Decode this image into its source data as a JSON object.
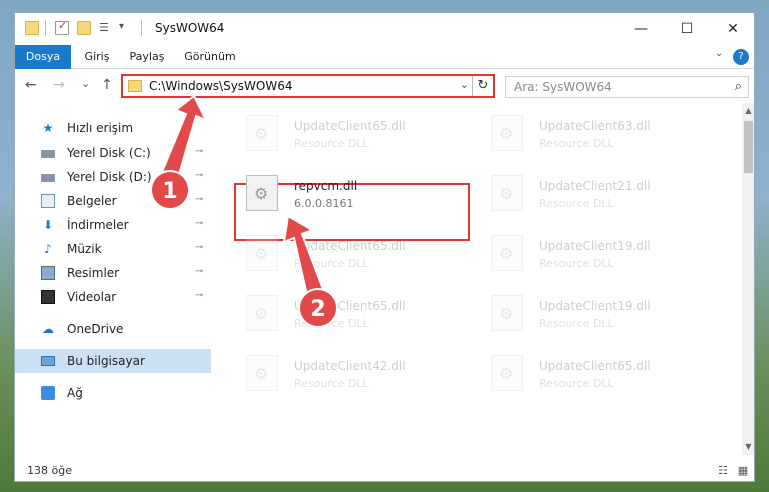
{
  "window": {
    "title": "SysWOW64",
    "controls": {
      "minimize": "—",
      "maximize": "☐",
      "close": "✕"
    }
  },
  "ribbon": {
    "tabs": [
      "Dosya",
      "Giriş",
      "Paylaş",
      "Görünüm"
    ],
    "help": "?",
    "collapse": "⌄"
  },
  "nav": {
    "back": "←",
    "forward": "→",
    "recent": "⌄",
    "up": "↑",
    "address": "C:\\Windows\\SysWOW64",
    "address_dropdown": "⌄",
    "refresh": "↻",
    "search_placeholder": "Ara: SysWOW64",
    "search_icon": "⌕"
  },
  "sidebar": {
    "items": [
      {
        "label": "Hızlı erişim",
        "icon": "star-icon",
        "glyph": "★",
        "pinned": false
      },
      {
        "label": "Yerel Disk (C:)",
        "icon": "drive-icon",
        "glyph": "",
        "pinned": true
      },
      {
        "label": "Yerel Disk (D:)",
        "icon": "drive-icon",
        "glyph": "",
        "pinned": true
      },
      {
        "label": "Belgeler",
        "icon": "documents-icon",
        "glyph": "",
        "pinned": true
      },
      {
        "label": "İndirmeler",
        "icon": "download-icon",
        "glyph": "⬇",
        "pinned": true
      },
      {
        "label": "Müzik",
        "icon": "music-icon",
        "glyph": "♪",
        "pinned": true
      },
      {
        "label": "Resimler",
        "icon": "pictures-icon",
        "glyph": "",
        "pinned": true
      },
      {
        "label": "Videolar",
        "icon": "videos-icon",
        "glyph": "",
        "pinned": true
      },
      {
        "label": "OneDrive",
        "icon": "cloud-icon",
        "glyph": "☁",
        "pinned": false
      },
      {
        "label": "Bu bilgisayar",
        "icon": "computer-icon",
        "glyph": "",
        "pinned": false,
        "selected": true
      },
      {
        "label": "Ağ",
        "icon": "network-icon",
        "glyph": "",
        "pinned": false
      }
    ],
    "pin_glyph": "📌"
  },
  "files": {
    "items": [
      {
        "name": "UpdateClient65.dll",
        "sub": "Resource DLL",
        "faded": true
      },
      {
        "name": "UpdateClient63.dll",
        "sub": "Resource DLL",
        "faded": true
      },
      {
        "name": "repvcm.dll",
        "sub": "6.0.0.8161",
        "faded": false
      },
      {
        "name": "UpdateClient21.dll",
        "sub": "Resource DLL",
        "faded": true
      },
      {
        "name": "UpdateClient65.dll",
        "sub": "Resource DLL",
        "faded": true
      },
      {
        "name": "UpdateClient19.dll",
        "sub": "Resource DLL",
        "faded": true
      },
      {
        "name": "UpdateClient65.dll",
        "sub": "Resource DLL",
        "faded": true
      },
      {
        "name": "UpdateClient19.dll",
        "sub": "Resource DLL",
        "faded": true
      },
      {
        "name": "UpdateClient42.dll",
        "sub": "Resource DLL",
        "faded": true
      },
      {
        "name": "UpdateClient65.dll",
        "sub": "Resource DLL",
        "faded": true
      }
    ]
  },
  "status": {
    "count": "138 öğe",
    "details_view": "☷",
    "tiles_view": "▦"
  },
  "annotations": {
    "badge1": "1",
    "badge2": "2",
    "accent": "#e03535"
  },
  "colors": {
    "ribbon_accent": "#1979ca",
    "selection": "#cde0f3"
  }
}
